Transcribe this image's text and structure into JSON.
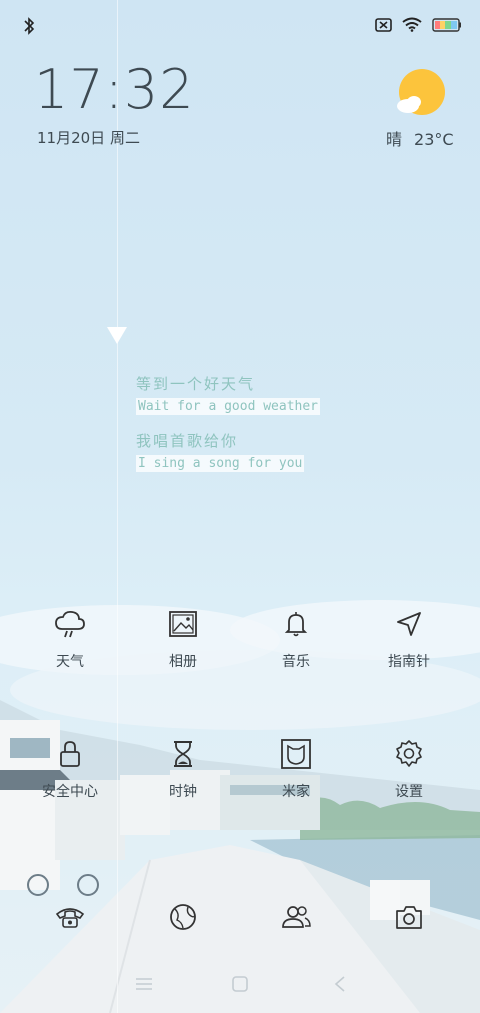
{
  "status_bar": {
    "left_icons": [
      "bluetooth-icon"
    ],
    "right_icons": [
      "no-sim-icon",
      "wifi-icon",
      "battery-icon"
    ]
  },
  "clock": {
    "time": "17:32",
    "date": "11月20日 周二"
  },
  "weather": {
    "condition": "晴",
    "temperature": "23°C",
    "icon": "sun-cloud-icon"
  },
  "lyrics": [
    {
      "cn": "等到一个好天气",
      "en": "Wait for a good weather"
    },
    {
      "cn": "我唱首歌给你",
      "en": "I sing a song for you"
    }
  ],
  "apps": [
    {
      "label": "天气",
      "icon": "cloud-rain-icon"
    },
    {
      "label": "相册",
      "icon": "photo-icon"
    },
    {
      "label": "音乐",
      "icon": "bell-icon"
    },
    {
      "label": "指南针",
      "icon": "compass-arrow-icon"
    },
    {
      "label": "安全中心",
      "icon": "lock-icon"
    },
    {
      "label": "时钟",
      "icon": "hourglass-icon"
    },
    {
      "label": "米家",
      "icon": "mijia-icon"
    },
    {
      "label": "设置",
      "icon": "gear-icon"
    }
  ],
  "dock": [
    {
      "icon": "phone-icon"
    },
    {
      "icon": "globe-icon"
    },
    {
      "icon": "contacts-icon"
    },
    {
      "icon": "camera-icon"
    }
  ],
  "nav_bar": {
    "buttons": [
      "menu-icon",
      "home-icon",
      "back-icon"
    ]
  },
  "colors": {
    "sky": "#d3e8f4",
    "text": "#3e4a52",
    "lyric": "#8fc4bf",
    "sun": "#fcc43c"
  }
}
